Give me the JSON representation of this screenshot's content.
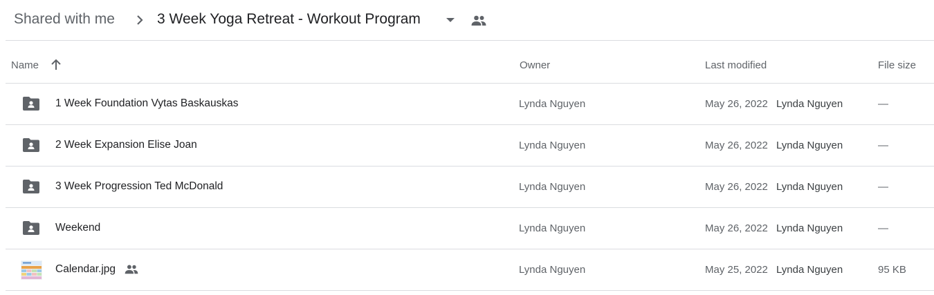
{
  "breadcrumb": {
    "root": "Shared with me",
    "current": "3 Week Yoga Retreat - Workout Program",
    "icons": {
      "separator": "chevron-right-icon",
      "dropdown": "arrow-drop-down-icon",
      "shared": "people-icon"
    }
  },
  "columns": {
    "name": "Name",
    "owner": "Owner",
    "last_modified": "Last modified",
    "file_size": "File size",
    "sort_icon": "arrow-up-icon"
  },
  "files": [
    {
      "name": "1 Week Foundation Vytas Baskauskas",
      "type": "shared-folder",
      "owner": "Lynda Nguyen",
      "modified_date": "May 26, 2022",
      "modified_by": "Lynda Nguyen",
      "size": "—",
      "shared": false
    },
    {
      "name": "2 Week Expansion Elise Joan",
      "type": "shared-folder",
      "owner": "Lynda Nguyen",
      "modified_date": "May 26, 2022",
      "modified_by": "Lynda Nguyen",
      "size": "—",
      "shared": false
    },
    {
      "name": "3 Week Progression Ted McDonald",
      "type": "shared-folder",
      "owner": "Lynda Nguyen",
      "modified_date": "May 26, 2022",
      "modified_by": "Lynda Nguyen",
      "size": "—",
      "shared": false
    },
    {
      "name": "Weekend",
      "type": "shared-folder",
      "owner": "Lynda Nguyen",
      "modified_date": "May 26, 2022",
      "modified_by": "Lynda Nguyen",
      "size": "—",
      "shared": false
    },
    {
      "name": "Calendar.jpg",
      "type": "image",
      "owner": "Lynda Nguyen",
      "modified_date": "May 25, 2022",
      "modified_by": "Lynda Nguyen",
      "size": "95 KB",
      "shared": true
    }
  ],
  "colors": {
    "text_primary": "#202124",
    "text_secondary": "#5f6368",
    "divider": "#dadce0",
    "icon": "#5f6368"
  }
}
